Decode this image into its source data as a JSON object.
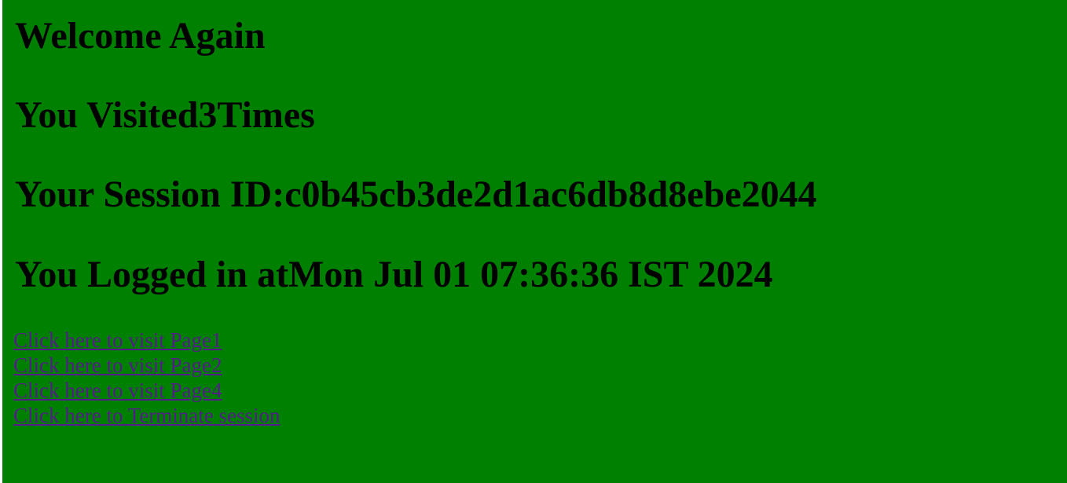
{
  "page": {
    "background_color": "#008000",
    "link_color": "#551a8b",
    "welcome_heading": "Welcome Again",
    "visits_heading": "You Visited3Times",
    "session_heading": "Your Session ID:c0b45cb3de2d1ac6db8d8ebe2044",
    "login_heading": "You Logged in atMon Jul 01 07:36:36 IST 2024"
  },
  "links": [
    {
      "label": "Click here to visit Page1"
    },
    {
      "label": "Click here to visit Page2"
    },
    {
      "label": "Click here to visit Page4"
    },
    {
      "label": "Click here to Terminate session"
    }
  ]
}
